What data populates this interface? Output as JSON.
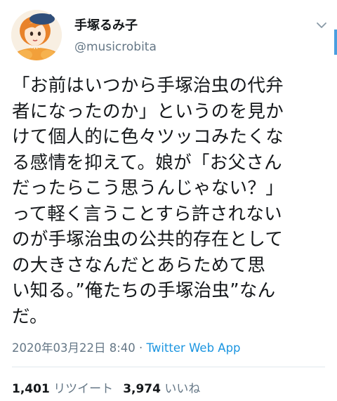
{
  "user": {
    "display_name": "手塚るみ子",
    "handle": "@musicrobita"
  },
  "tweet": {
    "lines": [
      "「お前はいつから手塚治虫の代弁",
      "者になったのか」というのを見か",
      "けて個人的に色々ツッコみたくな",
      "る感情を抑えて。娘が「お父さん",
      "だったらこう思うんじゃない？」",
      "って軽く言うことすら許されない",
      "のが手塚治虫の公共的存在として",
      "の大きさなんだとあらためて思",
      "い知る。”俺たちの手塚治虫”なん",
      "だ。"
    ],
    "timestamp": "2020年03月22日 8:40",
    "separator": " · ",
    "source_app": "Twitter Web App"
  },
  "stats": {
    "retweets_count": "1,401",
    "retweets_label": "リツイート",
    "likes_count": "3,974",
    "likes_label": "いいね"
  },
  "icons": {
    "menu": "chevron-down-icon",
    "avatar": "avatar-illustration"
  },
  "colors": {
    "text": "#14171a",
    "secondary": "#657786",
    "link": "#1b95e0",
    "divider": "#e1e8ed",
    "scrollbar": "#4a9fe0"
  }
}
